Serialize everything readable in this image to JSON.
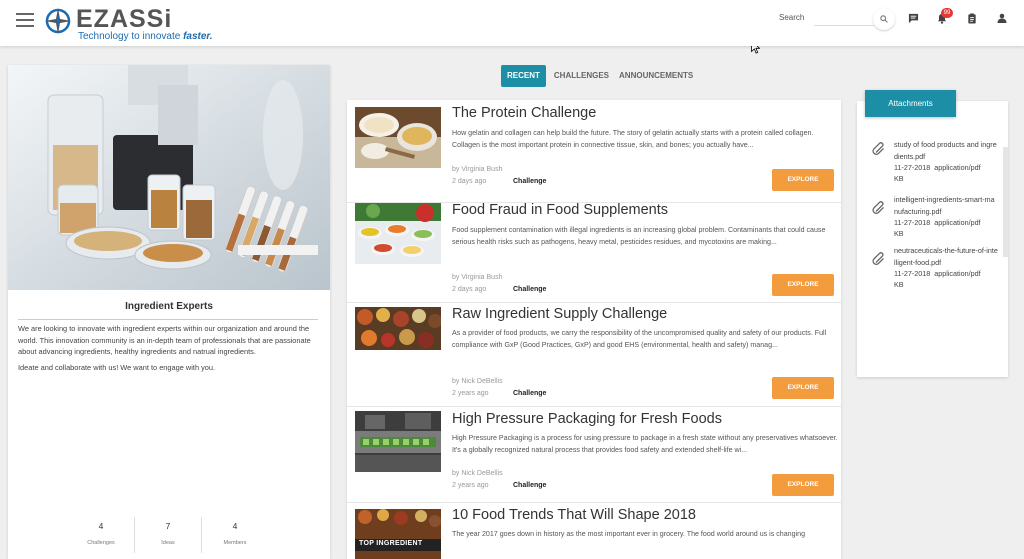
{
  "header": {
    "logo_text": "EZASSi",
    "tagline_prefix": "Technology to innovate ",
    "tagline_emphasis": "faster.",
    "search_label": "Search",
    "search_placeholder": "",
    "notification_count": "99",
    "icons": [
      "menu-icon",
      "search-icon",
      "chat-icon",
      "bell-icon",
      "clipboard-icon",
      "user-icon"
    ]
  },
  "community": {
    "title": "Ingredient Experts",
    "description": "We are looking to innovate with ingredient experts within our organization and around the world. This innovation community is an in-depth team of professionals that are passionate about advancing ingredients, healthy ingredients and natrual ingredients.",
    "cta": "Ideate and collaborate with us! We want to engage with you.",
    "stats": [
      {
        "value": "4",
        "label": "Challenges"
      },
      {
        "value": "7",
        "label": "Ideas"
      },
      {
        "value": "4",
        "label": "Members"
      }
    ]
  },
  "tabs": [
    {
      "label": "RECENT",
      "active": true
    },
    {
      "label": "CHALLENGES",
      "active": false
    },
    {
      "label": "ANNOUNCEMENTS",
      "active": false
    }
  ],
  "feed": [
    {
      "title": "The Protein Challenge",
      "description": "How gelatin and collagen can help build the future. The story of gelatin actually starts with a protein called collagen. Collagen is the most important protein in connective tissue, skin, and bones; you actually have...",
      "author": "by Virginia Bush",
      "time": "2 days ago",
      "type": "Challenge",
      "action": "EXPLORE"
    },
    {
      "title": "Food Fraud in Food Supplements",
      "description": "Food supplement contamination with illegal ingredients is an increasing global problem. Contaminants that could cause serious health risks such as pathogens, heavy metal, pesticides residues, and mycotoxins are making...",
      "author": "by Virginia Bush",
      "time": "2 days ago",
      "type": "Challenge",
      "action": "EXPLORE"
    },
    {
      "title": "Raw Ingredient Supply Challenge",
      "description": "As a provider of food products, we carry the responsibility of the uncompromised quality and safety of our products. Full compliance with GxP (Good Practices, GxP) and good EHS (environmental, health and safety) manag...",
      "author": "by Nick DeBellis",
      "time": "2 years ago",
      "type": "Challenge",
      "action": "EXPLORE"
    },
    {
      "title": "High Pressure Packaging for Fresh Foods",
      "description": "High Pressure Packaging is a process for using pressure to package in a fresh state without any preservatives whatsoever. It's a globally recognized natural process that provides food safety and extended shelf-life wi...",
      "author": "by Nick DeBellis",
      "time": "2 years ago",
      "type": "Challenge",
      "action": "EXPLORE"
    },
    {
      "title": "10 Food Trends That Will Shape 2018",
      "description": "The year 2017 goes down in history as the most important ever in grocery. The food world around us is changing",
      "thumb_caption": "TOP INGREDIENT",
      "author": "",
      "time": "",
      "type": "",
      "action": ""
    }
  ],
  "attachments": {
    "title": "Attachments",
    "items": [
      {
        "name": "study of food products and ingredients.pdf",
        "date": "11-27-2018",
        "type": "application/pdf",
        "size": "KB"
      },
      {
        "name": "intelligent-ingredients-smart-manufacturing.pdf",
        "date": "11-27-2018",
        "type": "application/pdf",
        "size": "KB"
      },
      {
        "name": "neutraceuticals-the-future-of-intelligent-food.pdf",
        "date": "11-27-2018",
        "type": "application/pdf",
        "size": "KB"
      }
    ]
  },
  "colors": {
    "accent": "#1c8fa6",
    "explore": "#f39c3d",
    "badge": "#e53935",
    "brand_blue": "#1b6cb0"
  }
}
